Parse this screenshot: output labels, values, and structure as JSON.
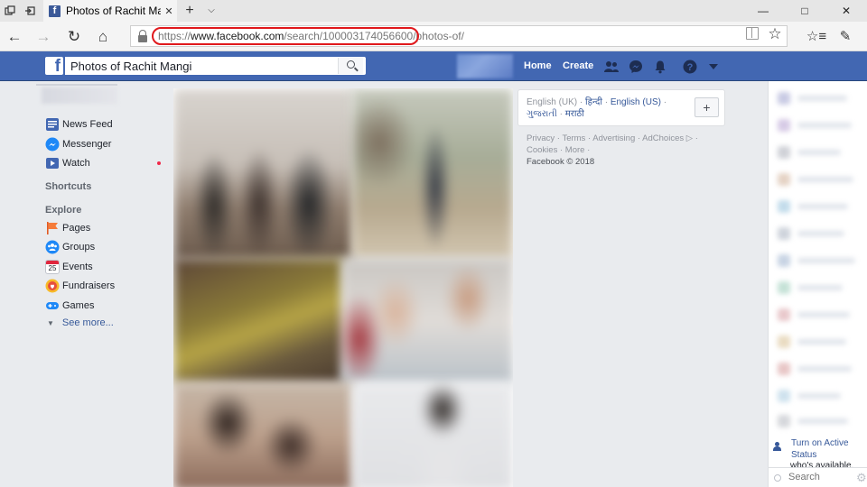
{
  "browser": {
    "tab": {
      "title": "Photos of Rachit Mangi",
      "favicon": "f"
    },
    "address": {
      "url_prefix": "https://",
      "url_domain": "www.facebook.com",
      "url_path": "/search/100003174056600/photos-of/"
    },
    "icons": {
      "tab_actions": "tab-actions-icon",
      "set_aside": "set-aside-tabs-icon",
      "new_tab": "+",
      "tab_list": "⌵",
      "back": "←",
      "forward": "→",
      "refresh": "↻",
      "home": "⌂",
      "favorite": "☆",
      "favorites_hub": "☆≡",
      "pen": "✎",
      "close": "✕"
    }
  },
  "fb_header": {
    "logo": "f",
    "search_value": "Photos of Rachit Mangi",
    "home": "Home",
    "create": "Create",
    "colors": {
      "bar": "#4267b2",
      "link": "#365899"
    }
  },
  "left_nav": {
    "items": [
      {
        "label": "News Feed",
        "icon": "news-feed-icon"
      },
      {
        "label": "Messenger",
        "icon": "messenger-icon"
      },
      {
        "label": "Watch",
        "icon": "watch-icon"
      }
    ],
    "shortcuts_title": "Shortcuts",
    "explore_title": "Explore",
    "explore": [
      {
        "label": "Pages",
        "icon": "pages-flag-icon"
      },
      {
        "label": "Groups",
        "icon": "groups-icon"
      },
      {
        "label": "Events",
        "icon": "events-calendar-icon",
        "day": "25"
      },
      {
        "label": "Fundraisers",
        "icon": "fundraisers-icon"
      },
      {
        "label": "Games",
        "icon": "games-icon"
      }
    ],
    "see_more": "See more..."
  },
  "languages": {
    "current": "English (UK)",
    "options": [
      "हिन्दी",
      "English (US)",
      "ગુજરાતી",
      "मराठी"
    ],
    "add": "+"
  },
  "footer": {
    "links": [
      "Privacy",
      "Terms",
      "Advertising",
      "AdChoices",
      "Cookies",
      "More"
    ],
    "copyright": "Facebook © 2018"
  },
  "chat": {
    "active_link": "Turn on Active Status",
    "active_sub": "who's available.",
    "search_placeholder": "Search",
    "gear": "⚙"
  }
}
